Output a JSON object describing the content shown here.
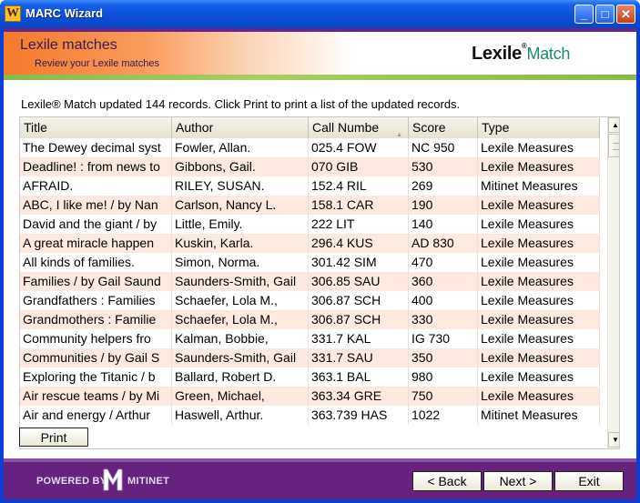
{
  "window": {
    "title": "MARC Wizard",
    "minimize": "_",
    "maximize": "□",
    "close": "✕"
  },
  "header": {
    "title": "Lexile matches",
    "subtitle": "Review your Lexile matches",
    "logo_main": "Lexile",
    "logo_reg": "®",
    "logo_match": "Match"
  },
  "info_text": "Lexile® Match updated 144 records.  Click Print to print a list of the updated records.",
  "table": {
    "columns": [
      "Title",
      "Author",
      "Call Numbe",
      "Score",
      "Type"
    ],
    "rows": [
      [
        "The Dewey decimal syst",
        "Fowler, Allan.",
        "025.4 FOW",
        "NC 950",
        "Lexile Measures"
      ],
      [
        "Deadline! : from news to",
        "Gibbons, Gail.",
        "070 GIB",
        "530",
        "Lexile Measures"
      ],
      [
        "AFRAID.",
        "RILEY, SUSAN.",
        "152.4 RIL",
        "269",
        "Mitinet Measures"
      ],
      [
        "ABC, I like me! / by Nan",
        "Carlson, Nancy L.",
        "158.1 CAR",
        "190",
        "Lexile Measures"
      ],
      [
        "David and the giant / by",
        "Little, Emily.",
        "222 LIT",
        "140",
        "Lexile Measures"
      ],
      [
        "A great miracle happen",
        "Kuskin, Karla.",
        "296.4 KUS",
        "AD 830",
        "Lexile Measures"
      ],
      [
        "All kinds of families.",
        "Simon, Norma.",
        "301.42 SIM",
        "470",
        "Lexile Measures"
      ],
      [
        "Families / by Gail Saund",
        "Saunders-Smith, Gail",
        "306.85 SAU",
        "360",
        "Lexile Measures"
      ],
      [
        "Grandfathers : Families",
        "Schaefer, Lola M.,",
        "306.87 SCH",
        "400",
        "Lexile Measures"
      ],
      [
        "Grandmothers : Familie",
        "Schaefer, Lola M.,",
        "306.87 SCH",
        "330",
        "Lexile Measures"
      ],
      [
        "Community helpers fro",
        "Kalman, Bobbie,",
        "331.7 KAL",
        "IG 730",
        "Lexile Measures"
      ],
      [
        "Communities / by Gail S",
        "Saunders-Smith, Gail",
        "331.7 SAU",
        "350",
        "Lexile Measures"
      ],
      [
        "Exploring the Titanic / b",
        "Ballard, Robert D.",
        "363.1 BAL",
        "980",
        "Lexile Measures"
      ],
      [
        "Air rescue teams / by Mi",
        "Green, Michael,",
        "363.34 GRE",
        "750",
        "Lexile Measures"
      ],
      [
        "Air and energy / Arthur",
        "Haswell, Arthur.",
        "363.739 HAS",
        "1022",
        "Mitinet Measures"
      ]
    ]
  },
  "buttons": {
    "print": "Print",
    "back": "< Back",
    "next": "Next >",
    "exit": "Exit"
  },
  "footer": {
    "powered_by": "POWERED BY",
    "brand": "MITINET"
  },
  "colors": {
    "footer_purple": "#66227e",
    "row_alt": "#fde9df",
    "accent_green": "#8ab84a",
    "header_orange": "#f47a2a"
  },
  "icons": {
    "app": "marc-wizard-icon",
    "sort": "sort-arrow-icon",
    "scroll_up": "scroll-up-icon",
    "scroll_down": "scroll-down-icon",
    "mitinet_logo": "mitinet-m-logo"
  }
}
